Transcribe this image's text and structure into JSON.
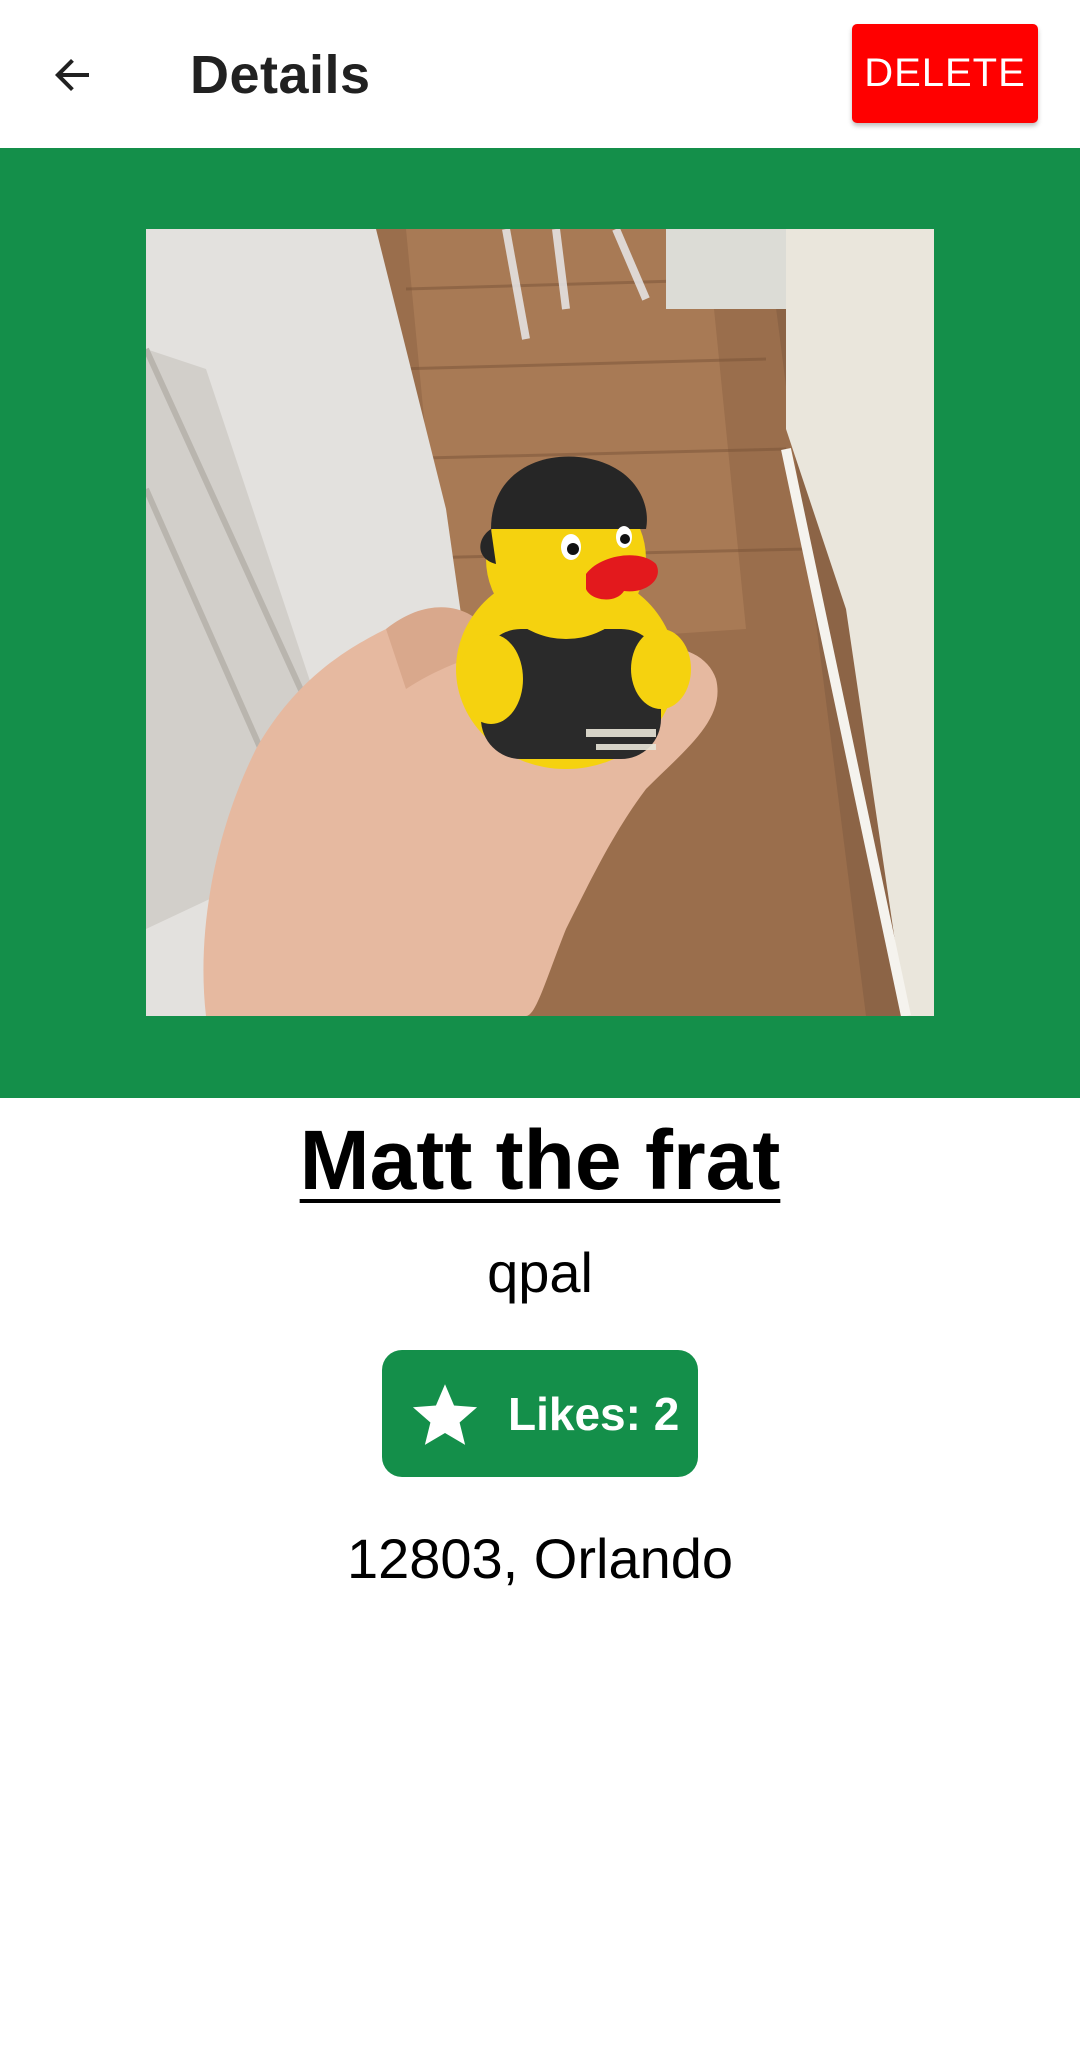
{
  "appbar": {
    "back_icon": "arrow-left-icon",
    "title": "Details",
    "delete_label": "DELETE"
  },
  "colors": {
    "accent_green": "#148f4a",
    "delete_red": "#ff0000"
  },
  "photo": {
    "subject": "photo"
  },
  "duck": {
    "name": "Matt the frat",
    "owner": "qpal",
    "likes_icon": "star-icon",
    "likes_label": "Likes: 2",
    "likes_count": 2,
    "location": "12803, Orlando"
  }
}
